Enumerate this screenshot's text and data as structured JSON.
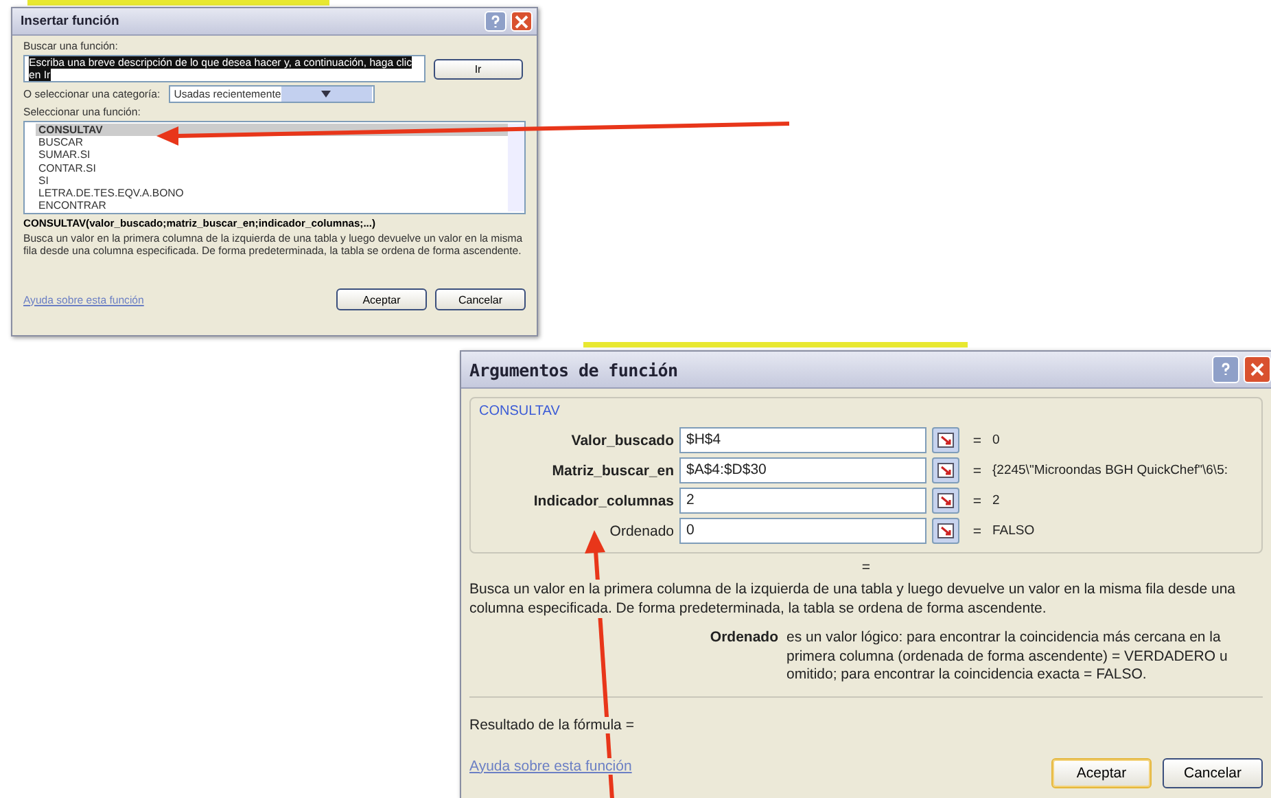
{
  "insert_dialog": {
    "title": "Insertar función",
    "search_label": "Buscar una función:",
    "search_value": "Escriba una breve descripción de lo que desea hacer y, a continuación, haga clic en Ir",
    "go_button": "Ir",
    "category_label": "O seleccionar una categoría:",
    "category_value": "Usadas recientemente",
    "list_label": "Seleccionar una función:",
    "functions": [
      {
        "label": "CONSULTAV",
        "selected": true
      },
      {
        "label": "BUSCAR",
        "selected": false
      },
      {
        "label": "SUMAR.SI",
        "selected": false
      },
      {
        "label": "CONTAR.SI",
        "selected": false
      },
      {
        "label": "SI",
        "selected": false
      },
      {
        "label": "LETRA.DE.TES.EQV.A.BONO",
        "selected": false
      },
      {
        "label": "ENCONTRAR",
        "selected": false
      }
    ],
    "syntax": "CONSULTAV(valor_buscado;matriz_buscar_en;indicador_columnas;...)",
    "description": "Busca un valor en la primera columna de la izquierda de una tabla y luego devuelve un valor en la misma fila desde una columna especificada. De forma predeterminada, la tabla se ordena de forma ascendente.",
    "help_link": "Ayuda sobre esta función",
    "buttons": [
      {
        "label": "Aceptar",
        "default": false
      },
      {
        "label": "Cancelar",
        "default": false
      }
    ]
  },
  "arguments_dialog": {
    "title": "Argumentos de función",
    "group": "CONSULTAV",
    "arguments": [
      {
        "name": "Valor_buscado",
        "required": true,
        "value": "$H$4",
        "equals": "=",
        "result": "0"
      },
      {
        "name": "Matriz_buscar_en",
        "required": true,
        "value": "$A$4:$D$30",
        "equals": "=",
        "result": "{2245\\\"Microondas BGH QuickChef\"\\6\\5:"
      },
      {
        "name": "Indicador_columnas",
        "required": true,
        "value": "2",
        "equals": "=",
        "result": "2"
      },
      {
        "name": "Ordenado",
        "required": false,
        "value": "0",
        "equals": "=",
        "result": "FALSO"
      }
    ],
    "overall_result": "=",
    "description": "Busca un valor en la primera columna de la izquierda de una tabla y luego devuelve un valor en la misma fila desde una columna especificada. De forma predeterminada, la tabla se ordena de forma ascendente.",
    "argument_help_name": "Ordenado",
    "argument_help_text": "es un valor lógico: para encontrar la coincidencia más cercana en la primera columna (ordenada de forma ascendente) = VERDADERO u omitido; para encontrar la coincidencia exacta = FALSO.",
    "formula_result": "Resultado de la fórmula =",
    "help_link": "Ayuda sobre esta función",
    "buttons": [
      {
        "label": "Aceptar",
        "default": true
      },
      {
        "label": "Cancelar",
        "default": false
      }
    ]
  }
}
